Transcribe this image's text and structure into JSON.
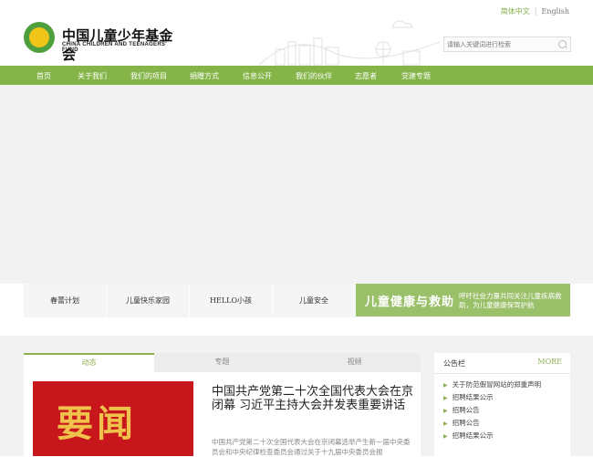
{
  "header": {
    "logo_name": "中国儿童少年基金会",
    "logo_en": "CHINA CHILDREN AND TEENAGERS' FUND",
    "lang_cn": "简体中文",
    "lang_sep": "|",
    "lang_en": "English",
    "search_placeholder": "请输入关键词进行检索"
  },
  "nav": {
    "items": [
      "首页",
      "关于我们",
      "我们的项目",
      "捐赠方式",
      "信息公开",
      "我们的伙伴",
      "志愿者",
      "党建专题"
    ]
  },
  "quick_links": [
    "春蕾计划",
    "儿童快乐家园",
    "HELLO小孩",
    "儿童安全"
  ],
  "promo": {
    "title": "儿童健康与救助",
    "text": "呼吁社会力量共同关注儿童疾病救助，为儿童健康保驾护航"
  },
  "tabs": [
    "动态",
    "专题",
    "视频"
  ],
  "featured": {
    "image_text": "要闻",
    "headline": "中国共产党第二十次全国代表大会在京闭幕 习近平主持大会并发表重要讲话",
    "excerpt": "中国共产党第二十次全国代表大会在京闭幕选举产生新一届中央委员会和中央纪律检查委员会通过关于十九届中央委员会报"
  },
  "notice": {
    "title": "公告栏",
    "more": "MORE",
    "items": [
      "关于防范假冒网站的郑重声明",
      "招聘结果公示",
      "招聘公告",
      "招聘公告",
      "招聘结果公示"
    ]
  },
  "colors": {
    "accent": "#85b448",
    "promo": "#9bc06a",
    "news_red": "#c7161c"
  }
}
